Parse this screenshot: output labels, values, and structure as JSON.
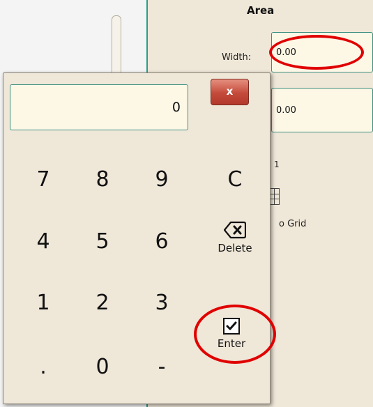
{
  "area": {
    "title": "Area",
    "width_label": "Width:",
    "width_value": "0.00",
    "height_value": "0.00"
  },
  "background": {
    "scale_label": "1",
    "grid_label": "o Grid"
  },
  "keypad": {
    "display_value": "0",
    "close_label": "x",
    "keys": [
      "7",
      "8",
      "9",
      "C",
      "4",
      "5",
      "6",
      "1",
      "2",
      "3",
      ".",
      "0",
      "-"
    ],
    "delete_label": "Delete",
    "enter_label": "Enter"
  },
  "colors": {
    "accent": "#3c8f80",
    "highlight": "#e00000",
    "panel": "#efe7d8",
    "field": "#fdf7e6"
  },
  "icons": {
    "delete": "backspace-icon",
    "enter": "checkmark-icon",
    "close": "close-icon"
  }
}
